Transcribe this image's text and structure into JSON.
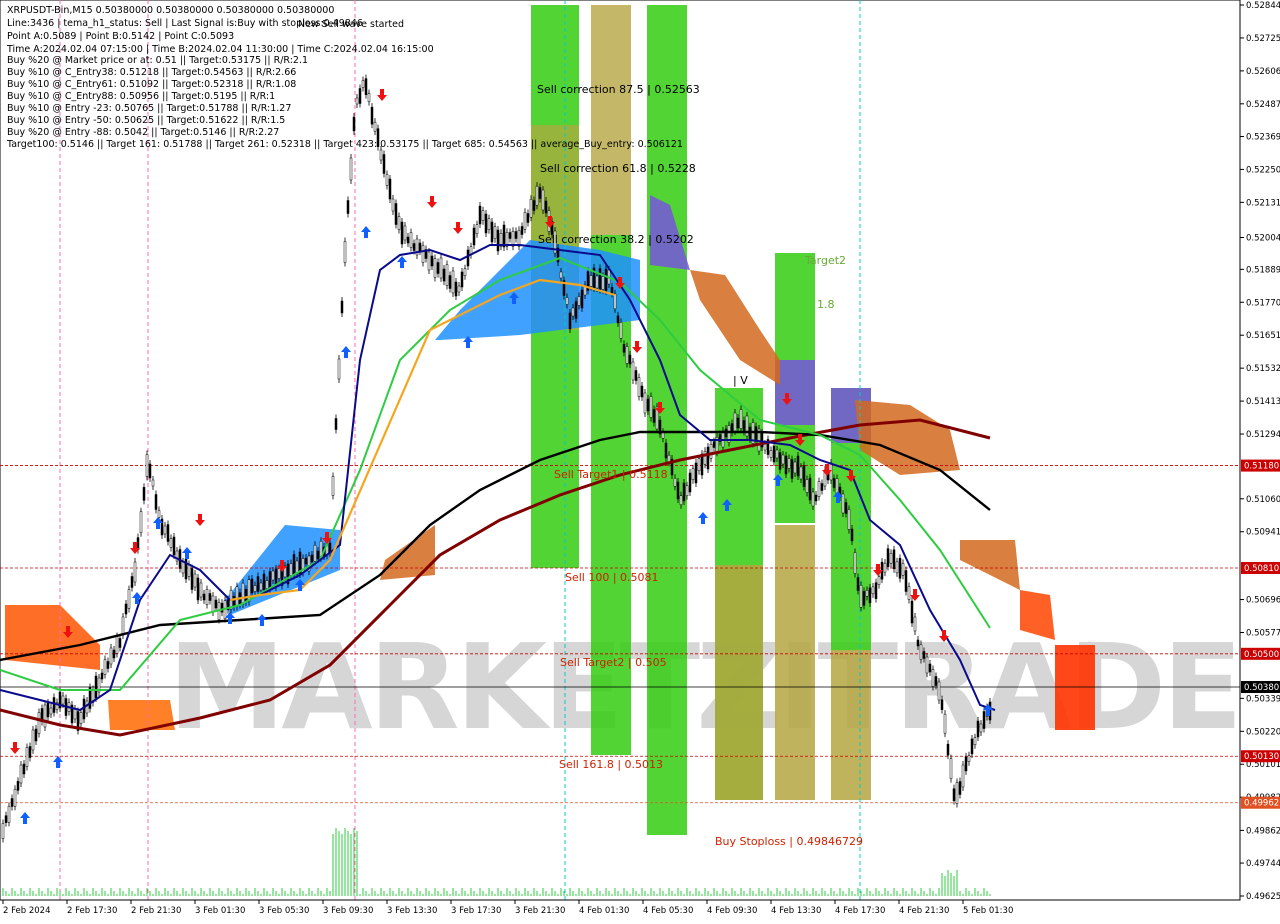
{
  "info_panel": {
    "lines": [
      "XRPUSDT-Bin,M15  0.50380000 0.50380000 0.50380000 0.50380000",
      "Line:3436  |  tema_h1_status: Sell  |  Last Signal is:Buy with stoploss:0.49846",
      "Point A:0.5089  |  Point B:0.5142  |  Point C:0.5093",
      "Time A:2024.02.04 07:15:00  |  Time B:2024.02.04 11:30:00  |  Time C:2024.02.04 16:15:00",
      "Buy %20 @ Market price or at: 0.51  ||  Target:0.53175  ||  R/R:2.1",
      "Buy %10 @ C_Entry38: 0.51218  ||  Target:0.54563  ||  R/R:2.66",
      "Buy %10 @ C_Entry61: 0.51092  ||  Target:0.52318  ||  R/R:1.08",
      "Buy %10 @ C_Entry88: 0.50956  ||  Target:0.5195  ||  R/R:1",
      "Buy %10 @ Entry -23: 0.50765  ||  Target:0.51788  ||  R/R:1.27",
      "Buy %10 @ Entry -50: 0.50625  ||  Target:0.51622  ||  R/R:1.5",
      "Buy %20 @ Entry -88: 0.5042  ||  Target:0.5146  ||  R/R:2.27",
      "Target100: 0.5146  ||  Target 161: 0.51788  ||  Target 261: 0.52318  ||  Target 423: 0.53175  ||  Target 685: 0.54563  ||  average_Buy_entry: 0.506121"
    ],
    "new_wave": "New Sell wave started"
  },
  "watermark": "MARKETZITRADE",
  "chart_data": {
    "type": "candlestick",
    "symbol": "XRPUSDT-Bin",
    "timeframe": "M15",
    "ylim": [
      0.49625,
      0.52844
    ],
    "y_ticks": [
      "0.52844",
      "0.52725",
      "0.52606",
      "0.52487",
      "0.52369",
      "0.52250",
      "0.52131",
      "0.52004",
      "0.51889",
      "0.51770",
      "0.51651",
      "0.51532",
      "0.51413",
      "0.51294",
      "0.51060",
      "0.50941",
      "0.50696",
      "0.50577",
      "0.50339",
      "0.50220",
      "0.50101",
      "0.49982",
      "0.49862",
      "0.49744",
      "0.49625"
    ],
    "x_ticks": [
      "2 Feb 2024",
      "2 Feb 17:30",
      "2 Feb 21:30",
      "3 Feb 01:30",
      "3 Feb 05:30",
      "3 Feb 09:30",
      "3 Feb 13:30",
      "3 Feb 17:30",
      "3 Feb 21:30",
      "4 Feb 01:30",
      "4 Feb 05:30",
      "4 Feb 09:30",
      "4 Feb 13:30",
      "4 Feb 17:30",
      "4 Feb 21:30",
      "5 Feb 01:30"
    ],
    "current_price": "0.50380",
    "price_levels": [
      {
        "price": 0.5118,
        "label": "0.51180",
        "color": "#cc0000"
      },
      {
        "price": 0.5081,
        "label": "0.50810",
        "color": "#cc0000"
      },
      {
        "price": 0.505,
        "label": "0.50500",
        "color": "#cc0000"
      },
      {
        "price": 0.5038,
        "label": "0.50380",
        "color": "#000000"
      },
      {
        "price": 0.5013,
        "label": "0.50130",
        "color": "#cc0000"
      },
      {
        "price": 0.49962,
        "label": "0.49962",
        "color": "#e05020"
      }
    ],
    "zone_labels": [
      {
        "text": "Sell correction 87.5 | 0.52563",
        "color": "#000000"
      },
      {
        "text": "Sell correction 61.8 | 0.5228",
        "color": "#000000"
      },
      {
        "text": "Sell correction 38.2 | 0.5202",
        "color": "#000000"
      },
      {
        "text": "Sell Target1 | 0.5118",
        "color": "#cc2200"
      },
      {
        "text": "Sell 100 | 0.5081",
        "color": "#cc2200"
      },
      {
        "text": "Sell Target2 | 0.505",
        "color": "#cc2200"
      },
      {
        "text": "Sell 161.8 | 0.5013",
        "color": "#cc2200"
      },
      {
        "text": "Buy Stoploss | 0.49846729",
        "color": "#cc2200"
      }
    ],
    "fragment_labels": [
      "Target2",
      "1.8",
      "| V"
    ],
    "series": [
      {
        "name": "price",
        "color": "#000000"
      },
      {
        "name": "tema",
        "color": "#0a0a8c"
      },
      {
        "name": "ma_fast",
        "color": "#2ecc40"
      },
      {
        "name": "ma_mid",
        "color": "#000000"
      },
      {
        "name": "ma_slow",
        "color": "#800000"
      }
    ]
  },
  "colors": {
    "bg": "#ffffff",
    "candle": "#000000",
    "cloud_orange": "#d2691e",
    "cloud_blue": "#1e90ff",
    "zone_green": "#33cc11",
    "zone_olive": "#b5a642",
    "zone_red": "#ff3300",
    "zone_purple": "#7755dd",
    "level_red": "#cc0000"
  }
}
